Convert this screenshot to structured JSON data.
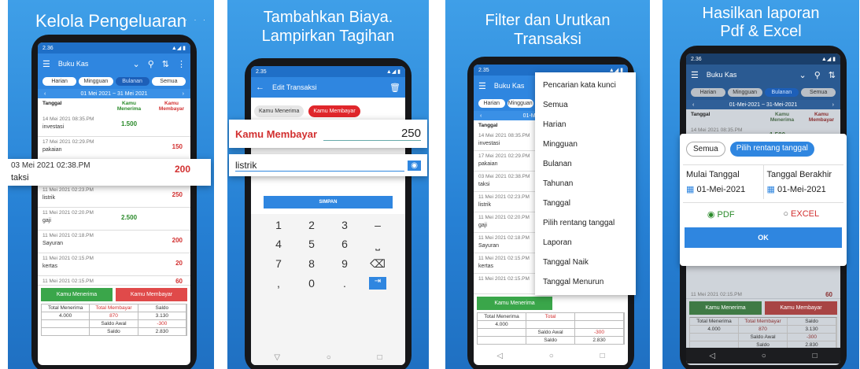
{
  "panels": {
    "p1": {
      "heading": "Kelola Pengeluaran",
      "status": {
        "time": "2.36"
      },
      "toolbar": {
        "title": "Buku Kas"
      },
      "tabs": [
        "Harian",
        "Mingguan",
        "Bulanan",
        "Semua"
      ],
      "date_range": "01 Mei 2021 ~ 31 Mei 2021",
      "headers": {
        "date": "Tanggal",
        "in": "Kamu Menerima",
        "out": "Kamu Membayar"
      },
      "rows": [
        {
          "date": "14 Mei 2021 08:35.PM",
          "name": "investasi",
          "in": "1.500",
          "out": ""
        },
        {
          "date": "17 Mei 2021 02:29.PM",
          "name": "pakaian",
          "in": "",
          "out": "150"
        },
        {
          "date": "11 Mei 2021 02:23.PM",
          "name": "listrik",
          "in": "",
          "out": "250"
        },
        {
          "date": "11 Mei 2021 02:20.PM",
          "name": "gaji",
          "in": "2.500",
          "out": ""
        },
        {
          "date": "11 Mei 2021 02:18.PM",
          "name": "Sayuran",
          "in": "",
          "out": "200"
        },
        {
          "date": "11 Mei 2021 02:15.PM",
          "name": "kertas",
          "in": "",
          "out": "20"
        }
      ],
      "highlight": {
        "date": "03 Mei 2021 02:38.PM",
        "name": "taksi",
        "amount": "200"
      },
      "partial_row": {
        "date": "11 Mei 2021 02:15.PM",
        "out": "60"
      },
      "buttons": {
        "receive": "Kamu Menerima",
        "pay": "Kamu Membayar"
      },
      "totals": {
        "h_in": "Total Menerima",
        "h_out": "Total Membayar",
        "h_bal": "Saldo",
        "v_in": "4.000",
        "v_out": "870",
        "v_bal": "3.130",
        "l_open": "Saldo Awal",
        "v_open": "-300",
        "l_bal": "Saldo",
        "v_final": "2.830"
      }
    },
    "p2": {
      "heading": "Tambahkan Biaya.\nLampirkan Tagihan",
      "status": {
        "time": "2.35"
      },
      "toolbar": {
        "title": "Edit Transaksi"
      },
      "chips": {
        "receive": "Kamu Menerima",
        "pay": "Kamu Membayar"
      },
      "pay_label": "Kamu Membayar",
      "amount": "250",
      "note": "listrik",
      "save": "SIMPAN",
      "keys": [
        "1",
        "2",
        "3",
        "–",
        "4",
        "5",
        "6",
        "⎵",
        "7",
        "8",
        "9",
        "⌫",
        ",",
        "0",
        ".",
        "⇥"
      ]
    },
    "p3": {
      "heading": "Filter dan Urutkan\nTransaksi",
      "status": {
        "time": "2.35"
      },
      "toolbar": {
        "title": "Buku Kas"
      },
      "tabs": [
        "Harian",
        "Mingguan"
      ],
      "date_range": "01-Mei-202",
      "menu": [
        "Pencarian kata kunci",
        "Semua",
        "Harian",
        "Mingguan",
        "Bulanan",
        "Tahunan",
        "Tanggal",
        "Pilih rentang tanggal",
        "Laporan",
        "Tanggal Naik",
        "Tanggal Menurun"
      ],
      "rows": [
        {
          "date": "14 Mei 2021 08:35.PM",
          "name": "investasi"
        },
        {
          "date": "17 Mei 2021 02:29.PM",
          "name": "pakaian"
        },
        {
          "date": "03 Mei 2021 02:38.PM",
          "name": "taksi"
        },
        {
          "date": "11 Mei 2021 02:23.PM",
          "name": "listrik"
        },
        {
          "date": "11 Mei 2021 02:20.PM",
          "name": "gaji"
        },
        {
          "date": "11 Mei 2021 02:18.PM",
          "name": "Sayuran"
        },
        {
          "date": "11 Mei 2021 02:15.PM",
          "name": "kertas"
        },
        {
          "date": "11 Mei 2021 02:15.PM",
          "name": ""
        }
      ],
      "hdr": "Tanggal",
      "buttons": {
        "receive": "Kamu Menerima"
      },
      "totals": {
        "h_in": "Total Menerima",
        "h_out": "Total",
        "v_in": "4.000",
        "l_open": "Saldo Awal",
        "v_open": "-300",
        "l_bal": "Saldo",
        "v_bal": "2.830"
      }
    },
    "p4": {
      "heading": "Hasilkan laporan\nPdf & Excel",
      "status": {
        "time": "2.36"
      },
      "toolbar": {
        "title": "Buku Kas"
      },
      "tabs": [
        "Harian",
        "Mingguan",
        "Bulanan",
        "Semua"
      ],
      "date_range": "01-Mei-2021 ~ 31-Mei-2021",
      "headers": {
        "date": "Tanggal",
        "in": "Kamu Menerima",
        "out": "Kamu Membayar"
      },
      "row1": {
        "date": "14 Mei 2021 08:35.PM",
        "in": "1.500"
      },
      "dialog": {
        "all": "Semua",
        "range": "Pilih rentang tanggal",
        "start_label": "Mulai Tanggal",
        "end_label": "Tanggal Berakhir",
        "start": "01-Mei-2021",
        "end": "01-Mei-2021",
        "pdf": "PDF",
        "excel": "EXCEL",
        "ok": "OK"
      },
      "below": {
        "date": "11 Mei 2021 02:15.PM",
        "out": "60"
      },
      "buttons": {
        "receive": "Kamu Menerima",
        "pay": "Kamu Membayar"
      },
      "totals": {
        "h_in": "Total Menerima",
        "h_out": "Total Membayar",
        "h_bal": "Saldo",
        "v_in": "4.000",
        "v_out": "870",
        "v_bal": "3.130",
        "l_open": "Saldo Awal",
        "v_open": "-300",
        "l_bal": "Saldo",
        "v_final": "2.830"
      }
    }
  },
  "colors": {
    "blue": "#2f86e0",
    "green": "#3aa64a",
    "red": "#e04a4a"
  }
}
